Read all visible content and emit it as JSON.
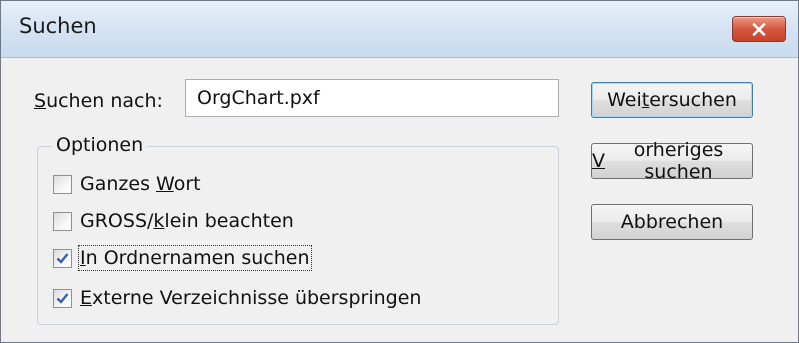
{
  "dialog": {
    "title": "Suchen"
  },
  "search": {
    "label_prefix": "",
    "label_accel": "S",
    "label_rest": "uchen nach:",
    "value": "OrgChart.pxf"
  },
  "options": {
    "legend": "Optionen",
    "items": [
      {
        "pre": "Ganzes ",
        "accel": "W",
        "post": "ort",
        "checked": false
      },
      {
        "pre": "GROSS/",
        "accel": "k",
        "post": "lein beachten",
        "checked": false
      },
      {
        "pre": "",
        "accel": "I",
        "post": "n Ordnernamen suchen",
        "checked": true
      },
      {
        "pre": "",
        "accel": "E",
        "post": "xterne Verzeichnisse überspringen",
        "checked": true
      }
    ]
  },
  "buttons": {
    "find_next": {
      "pre": "Wei",
      "accel": "t",
      "post": "ersuchen"
    },
    "find_prev": {
      "pre": "",
      "accel": "V",
      "post": "orheriges suchen"
    },
    "cancel": "Abbrechen"
  },
  "colors": {
    "titlebar": "#d6e4f3",
    "close": "#c4422a",
    "client": "#f0f0f0",
    "checkmark": "#3a5fa8"
  }
}
